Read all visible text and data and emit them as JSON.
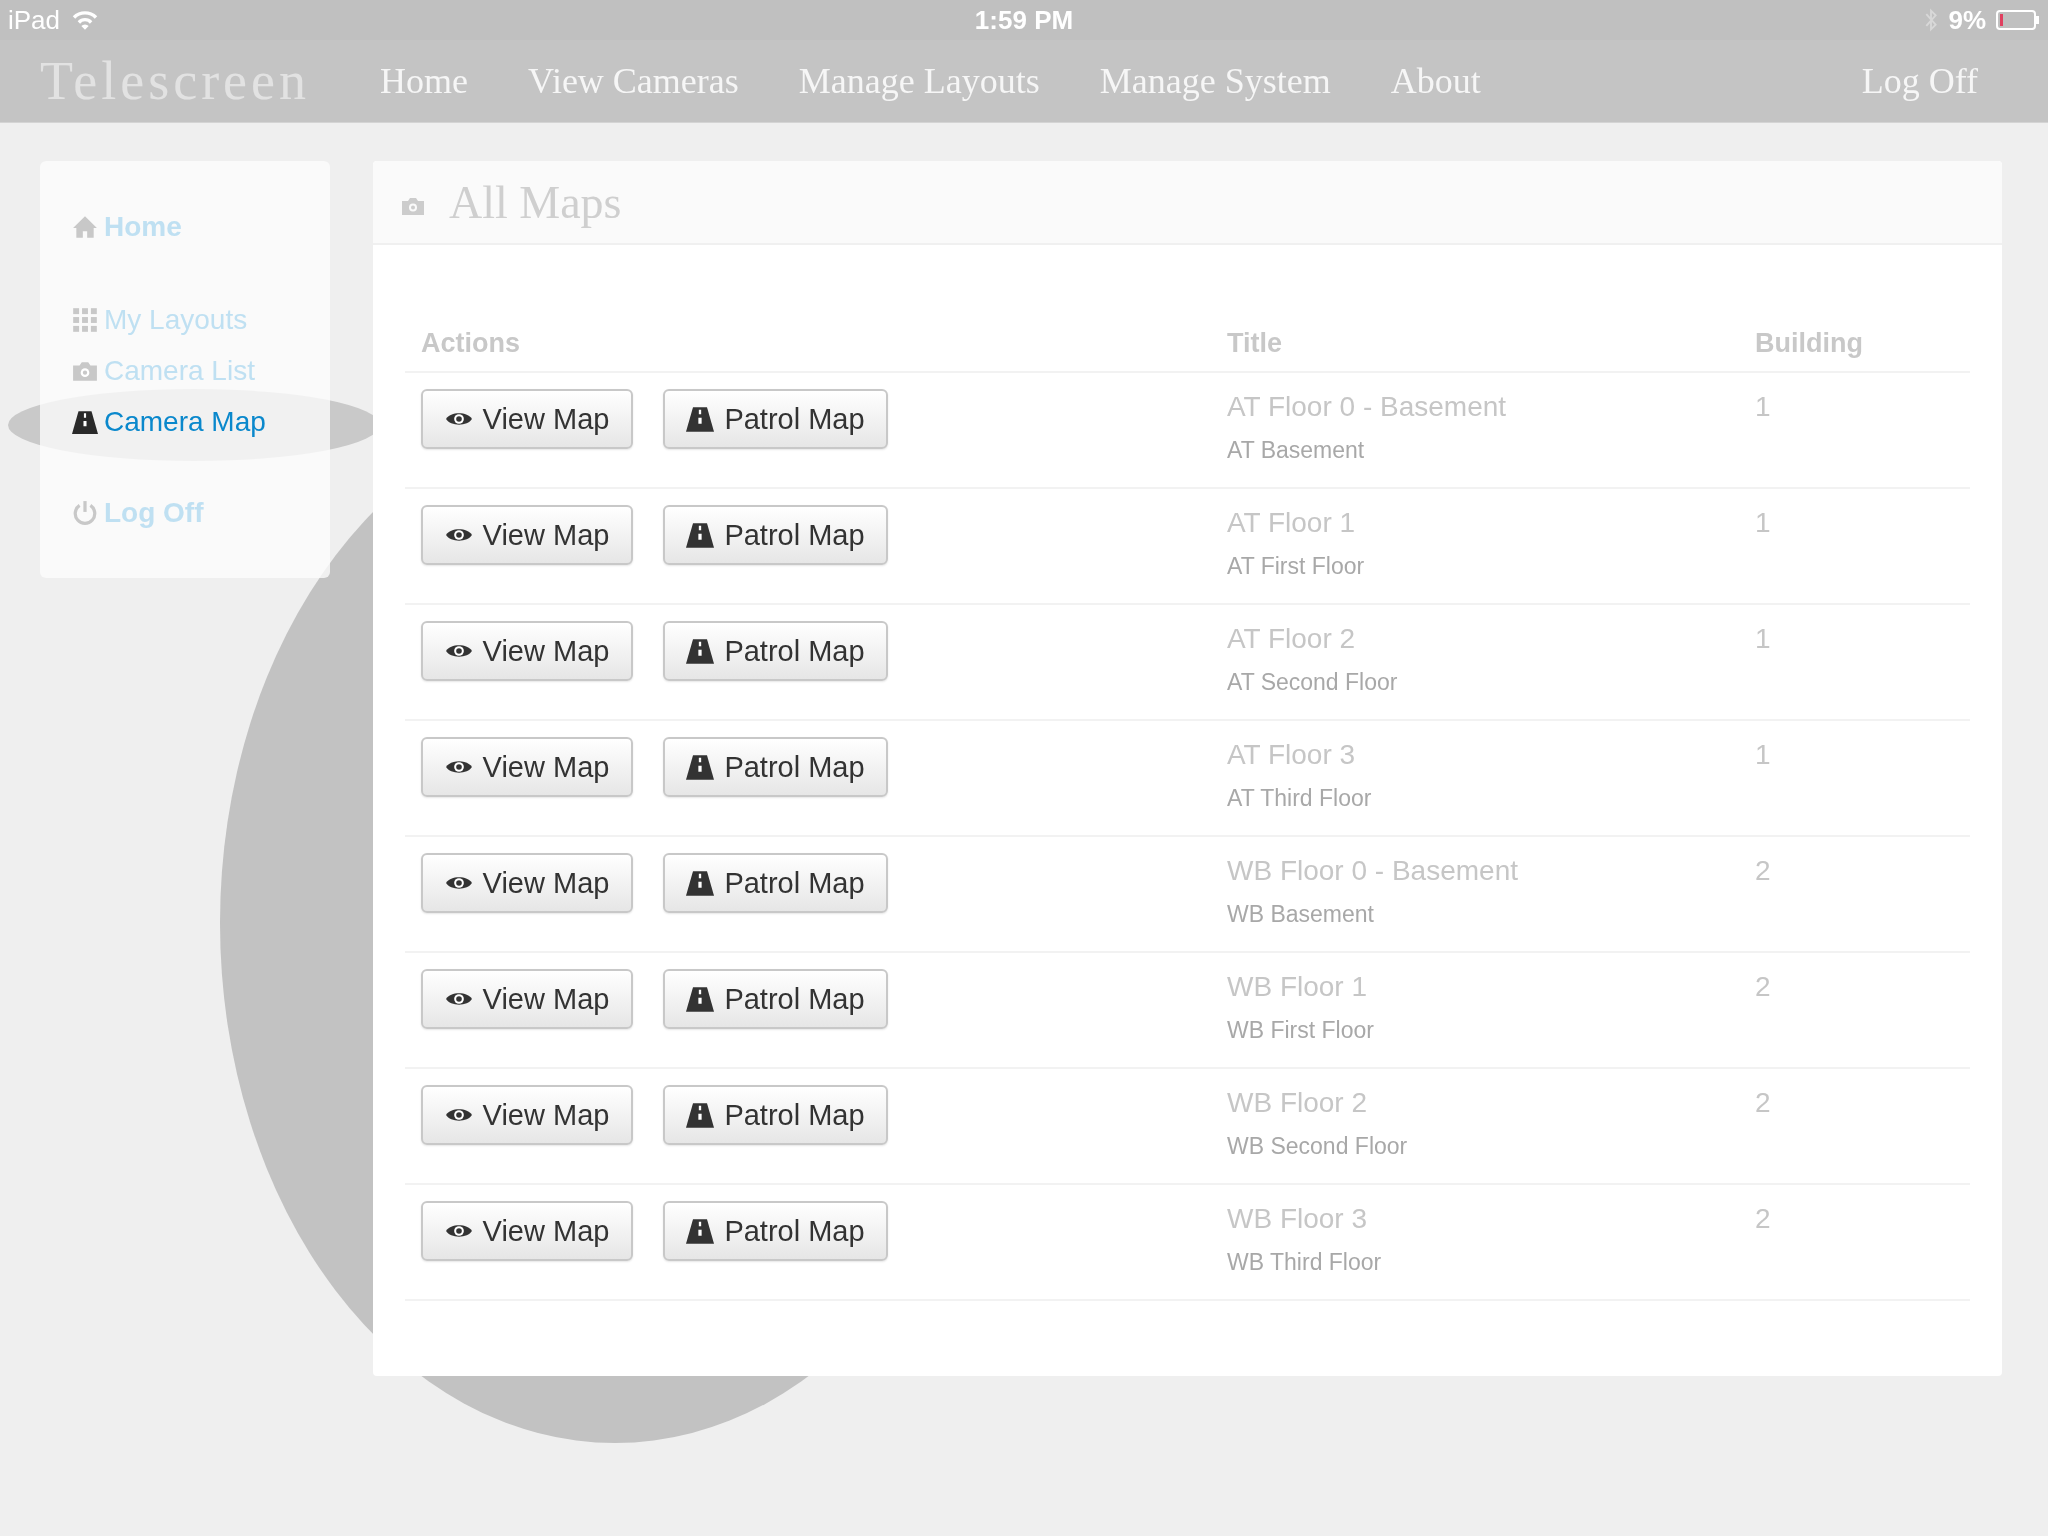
{
  "status_bar": {
    "device": "iPad",
    "time": "1:59 PM",
    "battery": "9%"
  },
  "navbar": {
    "brand": "Telescreen",
    "links": [
      "Home",
      "View Cameras",
      "Manage Layouts",
      "Manage System",
      "About"
    ],
    "logoff": "Log Off"
  },
  "sidebar": {
    "items": [
      {
        "label": "Home",
        "kind": "primary",
        "selected": false
      },
      {
        "label": "My Layouts",
        "kind": "secondary",
        "selected": false
      },
      {
        "label": "Camera List",
        "kind": "secondary",
        "selected": false
      },
      {
        "label": "Camera Map",
        "kind": "secondary",
        "selected": true
      },
      {
        "label": "Log Off",
        "kind": "primary",
        "selected": false
      }
    ]
  },
  "panel": {
    "title": "All Maps",
    "table": {
      "columns": [
        "Actions",
        "Title",
        "Building"
      ],
      "rows": [
        {
          "actions": [
            "View Map",
            "Patrol Map"
          ],
          "title": "AT Floor 0 - Basement",
          "subtitle": "AT Basement",
          "building": "1"
        },
        {
          "actions": [
            "View Map",
            "Patrol Map"
          ],
          "title": "AT Floor 1",
          "subtitle": "AT First Floor",
          "building": "1"
        },
        {
          "actions": [
            "View Map",
            "Patrol Map"
          ],
          "title": "AT Floor 2",
          "subtitle": "AT Second Floor",
          "building": "1"
        },
        {
          "actions": [
            "View Map",
            "Patrol Map"
          ],
          "title": "AT Floor 3",
          "subtitle": "AT Third Floor",
          "building": "1"
        },
        {
          "actions": [
            "View Map",
            "Patrol Map"
          ],
          "title": "WB Floor 0 - Basement",
          "subtitle": "WB Basement",
          "building": "2"
        },
        {
          "actions": [
            "View Map",
            "Patrol Map"
          ],
          "title": "WB Floor 1",
          "subtitle": "WB First Floor",
          "building": "2"
        },
        {
          "actions": [
            "View Map",
            "Patrol Map"
          ],
          "title": "WB Floor 2",
          "subtitle": "WB Second Floor",
          "building": "2"
        },
        {
          "actions": [
            "View Map",
            "Patrol Map"
          ],
          "title": "WB Floor 3",
          "subtitle": "WB Third Floor",
          "building": "2"
        }
      ]
    }
  }
}
